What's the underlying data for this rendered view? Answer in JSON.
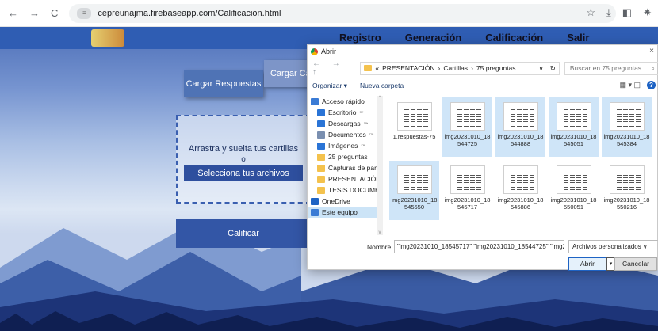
{
  "browser": {
    "back": "←",
    "forward": "→",
    "reload": "C",
    "url": "cepreunajma.firebaseapp.com/Calificacion.html",
    "site_info": "≡",
    "bookmark": "☆",
    "download": "⤓",
    "panel": "◧",
    "extension": "✷"
  },
  "nav": {
    "logo": "",
    "items": [
      "Registro",
      "Generación",
      "Calificación",
      "Salir"
    ]
  },
  "main": {
    "cargar_respuestas": "Cargar Respuestas",
    "cargar_cartillas": "Cargar Ca",
    "drop_text": "Arrastra y suelta tus cartillas",
    "drop_or": "o",
    "select_files": "Selecciona tus archivos",
    "calificar": "Calificar"
  },
  "dialog": {
    "title": "Abrir",
    "close": "×",
    "nav_arrows": "← → ↑",
    "path": [
      "«",
      "PRESENTACIÓN",
      "›",
      "Cartillas",
      "›",
      "75 preguntas"
    ],
    "path_dropdown": "∨",
    "refresh": "↻",
    "search_placeholder": "Buscar en 75 preguntas",
    "search_icon": "⌕",
    "organize": "Organizar ▾",
    "new_folder": "Nueva carpeta",
    "view_icons": "▦ ▾  ◫",
    "help": "?",
    "sidebar": [
      {
        "label": "Acceso rápido",
        "icon": "star-icon",
        "color": "#3a7bd5",
        "pin": false,
        "selected": false
      },
      {
        "label": "Escritorio",
        "icon": "desktop-icon",
        "color": "#2a74d6",
        "pin": true,
        "selected": false
      },
      {
        "label": "Descargas",
        "icon": "download-icon",
        "color": "#2a74d6",
        "pin": true,
        "selected": false
      },
      {
        "label": "Documentos",
        "icon": "document-icon",
        "color": "#7a8fb0",
        "pin": true,
        "selected": false
      },
      {
        "label": "Imágenes",
        "icon": "pictures-icon",
        "color": "#2a74d6",
        "pin": true,
        "selected": false
      },
      {
        "label": "25 preguntas",
        "icon": "folder-icon",
        "color": "#f4c24d",
        "pin": false,
        "selected": false
      },
      {
        "label": "Capturas de pan",
        "icon": "folder-icon",
        "color": "#f4c24d",
        "pin": false,
        "selected": false
      },
      {
        "label": "PRESENTACIÓN",
        "icon": "folder-icon",
        "color": "#f4c24d",
        "pin": false,
        "selected": false
      },
      {
        "label": "TESIS DOCUMEN",
        "icon": "folder-icon",
        "color": "#f4c24d",
        "pin": false,
        "selected": false
      },
      {
        "label": "OneDrive",
        "icon": "cloud-icon",
        "color": "#1e63c4",
        "pin": false,
        "selected": false
      },
      {
        "label": "Este equipo",
        "icon": "computer-icon",
        "color": "#3a7bd5",
        "pin": false,
        "selected": true
      }
    ],
    "pin_glyph": "✑",
    "scroll_up": "^",
    "scroll_down": "v",
    "files": [
      {
        "name": "1.respuestas-75",
        "selected": false
      },
      {
        "name": "img20231010_18544725",
        "selected": true
      },
      {
        "name": "img20231010_18544888",
        "selected": true
      },
      {
        "name": "img20231010_18545051",
        "selected": true
      },
      {
        "name": "img20231010_18545384",
        "selected": true
      },
      {
        "name": "img20231010_18545550",
        "selected": true
      },
      {
        "name": "img20231010_18545717",
        "selected": false
      },
      {
        "name": "img20231010_18545886",
        "selected": false
      },
      {
        "name": "img20231010_18550051",
        "selected": false
      },
      {
        "name": "img20231010_18550216",
        "selected": false
      }
    ],
    "filename_label": "Nombre:",
    "filename_value": "\"img20231010_18545717\" \"img20231010_18544725\" \"img2023 ∨",
    "filetype": "Archivos personalizados      ∨",
    "open": "Abrir",
    "open_dropdown": "▾",
    "cancel": "Cancelar"
  }
}
